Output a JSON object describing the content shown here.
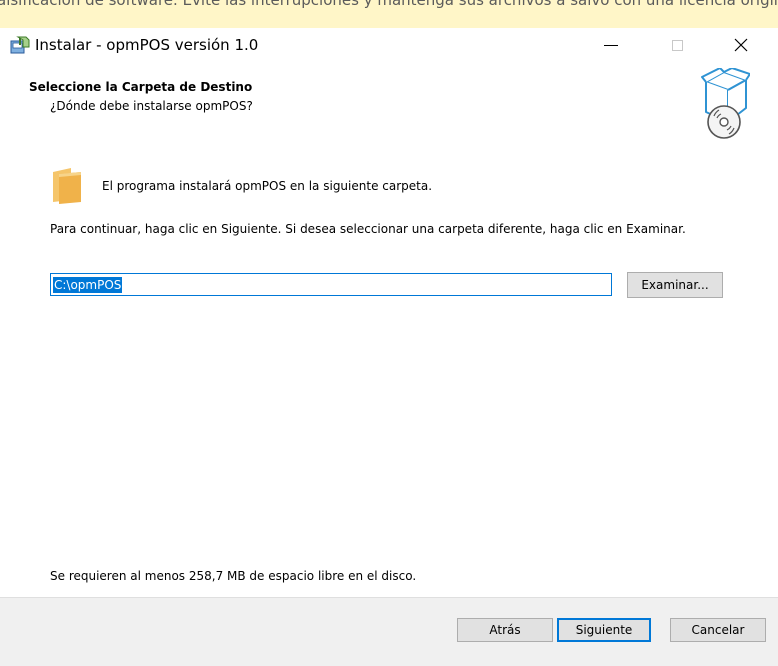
{
  "background_banner": {
    "text": "alsificación de software. Evite las interrupciones y mantenga sus archivos a salvo con una licencia origina"
  },
  "window": {
    "title": "Instalar - opmPOS versión 1.0",
    "app_icon": "installer-icon",
    "controls": {
      "minimize": "minimize-icon",
      "maximize": "maximize-icon",
      "close": "close-icon"
    }
  },
  "header": {
    "title": "Seleccione la Carpeta de Destino",
    "subtitle": "¿Dónde debe instalarse opmPOS?",
    "icon": "box-disc-icon"
  },
  "body": {
    "folder_icon": "folder-icon",
    "info": "El programa instalará opmPOS en la siguiente carpeta.",
    "instructions": "Para continuar, haga clic en Siguiente. Si desea seleccionar una carpeta diferente, haga clic en Examinar.",
    "path": "C:\\opmPOS",
    "browse_label": "Examinar...",
    "disk_space": "Se requieren al menos 258,7 MB de espacio libre en el disco."
  },
  "footer": {
    "back_label": "Atrás",
    "next_label": "Siguiente",
    "cancel_label": "Cancelar"
  },
  "colors": {
    "accent": "#0078d7",
    "footer_bg": "#f0f0f0",
    "banner_bg": "#fff6c8"
  }
}
